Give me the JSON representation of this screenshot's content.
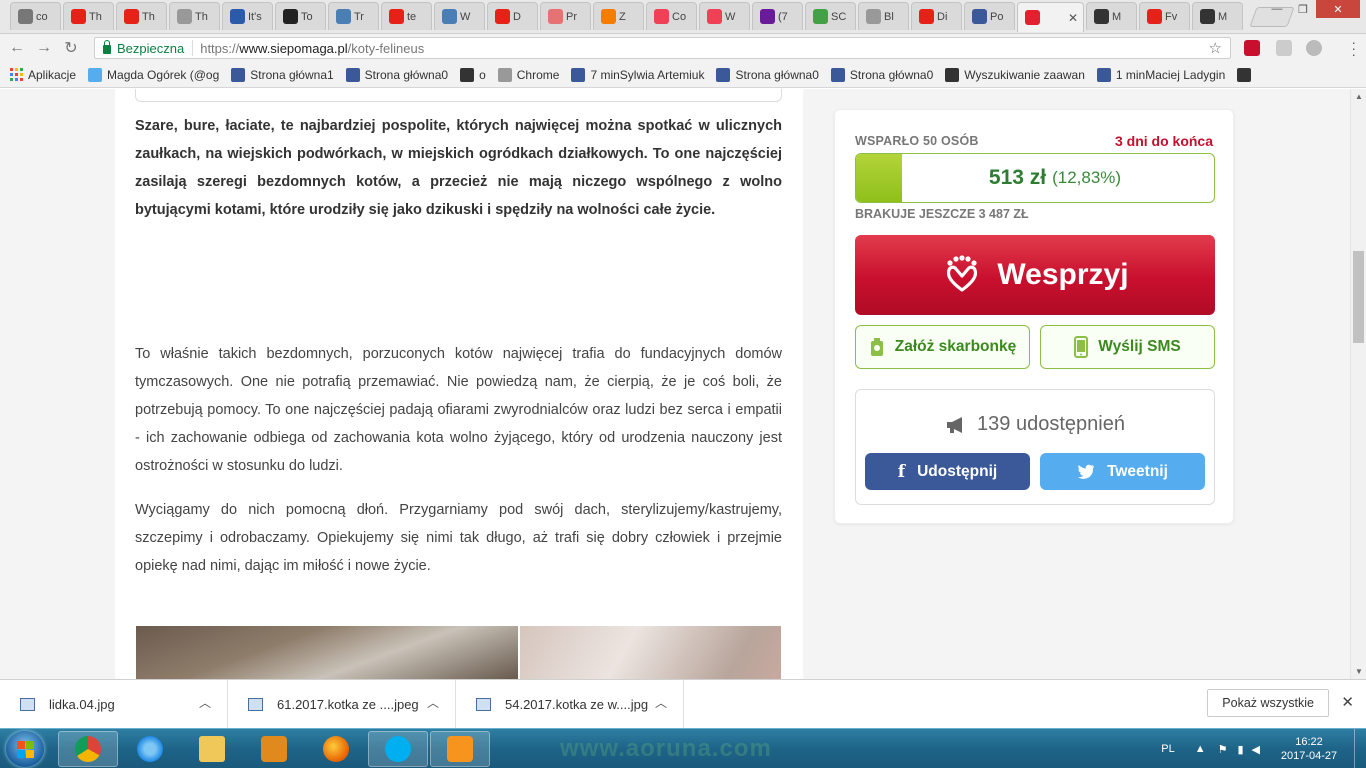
{
  "browser": {
    "tabs": [
      {
        "label": "co",
        "icon": "image-icon",
        "color": "#777777"
      },
      {
        "label": "Th",
        "icon": "youtube-icon",
        "color": "#e62117"
      },
      {
        "label": "Th",
        "icon": "youtube-icon",
        "color": "#e62117"
      },
      {
        "label": "Th",
        "icon": "page-icon",
        "color": "#999999"
      },
      {
        "label": "It's",
        "icon": "et-icon",
        "color": "#2b5aa8"
      },
      {
        "label": "To",
        "icon": "circle-icon",
        "color": "#222222"
      },
      {
        "label": "Tr",
        "icon": "translate-icon",
        "color": "#4a7fb5"
      },
      {
        "label": "te",
        "icon": "youtube-icon",
        "color": "#e62117"
      },
      {
        "label": "W",
        "icon": "translate-icon",
        "color": "#4a7fb5"
      },
      {
        "label": "D",
        "icon": "youtube-icon",
        "color": "#e62117"
      },
      {
        "label": "Pr",
        "icon": "doc-icon",
        "color": "#e57373"
      },
      {
        "label": "Z",
        "icon": "blogger-icon",
        "color": "#f57d00"
      },
      {
        "label": "Co",
        "icon": "pocket-icon",
        "color": "#ef4056"
      },
      {
        "label": "W",
        "icon": "pocket-icon",
        "color": "#ef4056"
      },
      {
        "label": "(7",
        "icon": "mail-icon",
        "color": "#6a1b9a"
      },
      {
        "label": "SC",
        "icon": "star-icon",
        "color": "#43a047"
      },
      {
        "label": "Bl",
        "icon": "page-icon",
        "color": "#999999"
      },
      {
        "label": "Di",
        "icon": "youtube-icon",
        "color": "#e62117"
      },
      {
        "label": "Po",
        "icon": "facebook-icon",
        "color": "#3b5998"
      },
      {
        "label": "",
        "icon": "siepomaga-heart-icon",
        "color": "#e4202e",
        "active": true
      },
      {
        "label": "M",
        "icon": "cat-icon",
        "color": "#333333"
      },
      {
        "label": "Fv",
        "icon": "fv-icon",
        "color": "#e62117"
      },
      {
        "label": "M",
        "icon": "cat-icon",
        "color": "#333333"
      }
    ],
    "address": {
      "secure_label": "Bezpieczna",
      "protocol": "https://",
      "host": "www.siepomaga.pl",
      "path": "/koty-felineus"
    },
    "bookmarks": [
      {
        "label": "Aplikacje",
        "icon": "apps-grid-icon",
        "color": "#4285f4"
      },
      {
        "label": "Magda Ogórek (@og",
        "icon": "twitter-icon",
        "color": "#55acee"
      },
      {
        "label": "Strona główna1",
        "icon": "facebook-icon",
        "color": "#3b5998"
      },
      {
        "label": "Strona główna0",
        "icon": "facebook-icon",
        "color": "#3b5998"
      },
      {
        "label": "o",
        "icon": "cat-icon",
        "color": "#333333"
      },
      {
        "label": "Chrome",
        "icon": "page-icon",
        "color": "#999999"
      },
      {
        "label": "7 minSylwia Artemiuk",
        "icon": "facebook-icon",
        "color": "#3b5998"
      },
      {
        "label": "Strona główna0",
        "icon": "facebook-icon",
        "color": "#3b5998"
      },
      {
        "label": "Strona główna0",
        "icon": "facebook-icon",
        "color": "#3b5998"
      },
      {
        "label": "Wyszukiwanie zaawan",
        "icon": "cat-icon",
        "color": "#333333"
      },
      {
        "label": "1 minMaciej Ladygin",
        "icon": "facebook-icon",
        "color": "#3b5998"
      },
      {
        "label": "",
        "icon": "cat-icon",
        "color": "#333333"
      }
    ]
  },
  "article": {
    "intro_bold": "Szare, bure, łaciate, te najbardziej pospolite, których najwięcej można spotkać w ulicznych zaułkach, na wiejskich podwórkach, w miejskich ogródkach działkowych. To one najczęściej zasilają szeregi bezdomnych kotów, a przecież nie mają niczego wspólnego z wolno bytującymi kotami, które urodziły się jako dzikuski i spędziły na wolności całe życie.",
    "paragraph_2": "To właśnie takich bezdomnych, porzuconych kotów najwięcej trafia do fundacyjnych domów tymczasowych. One nie potrafią przemawiać. Nie powiedzą nam, że cierpią, że je coś boli, że potrzebują pomocy. To one najczęściej padają ofiarami zwyrodnialców oraz ludzi bez serca i empatii - ich zachowanie odbiega od zachowania kota wolno żyjącego, który od urodzenia nauczony jest ostrożności w stosunku do ludzi.",
    "paragraph_3": "Wyciągamy do nich pomocną dłoń. Przygarniamy pod swój dach, sterylizujemy/kastrujemy, szczepimy i odrobaczamy. Opiekujemy się nimi tak długo, aż trafi się dobry człowiek i przejmie opiekę nad nimi, dając im miłość i nowe życie."
  },
  "campaign": {
    "supporters": "WSPARŁO 50 OSÓB",
    "days_left": "3 dni do końca",
    "amount": "513 zł",
    "percent_label": "(12,83%)",
    "progress_fraction": 0.1283,
    "missing": "BRAKUJE JESZCZE 3 487 ZŁ",
    "donate_label": "Wesprzyj",
    "piggybank_label": "Załóż skarbonkę",
    "sms_label": "Wyślij SMS",
    "shares": "139 udostępnień",
    "facebook_label": "Udostępnij",
    "twitter_label": "Tweetnij",
    "colors": {
      "donate": "#c8102e",
      "progress": "#8fbf1a",
      "facebook": "#3b5998",
      "twitter": "#55acee"
    }
  },
  "downloads": {
    "items": [
      "lidka.04.jpg",
      "61.2017.kotka ze ....jpeg",
      "54.2017.kotka ze w....jpg"
    ],
    "show_all": "Pokaż wszystkie"
  },
  "taskbar": {
    "apps": [
      "windows-start-icon",
      "chrome-icon",
      "ie-icon",
      "explorer-folder-icon",
      "media-player-icon",
      "firefox-icon",
      "skype-icon",
      "pdf-app-icon"
    ],
    "language": "PL",
    "time": "16:22",
    "date": "2017-04-27"
  }
}
